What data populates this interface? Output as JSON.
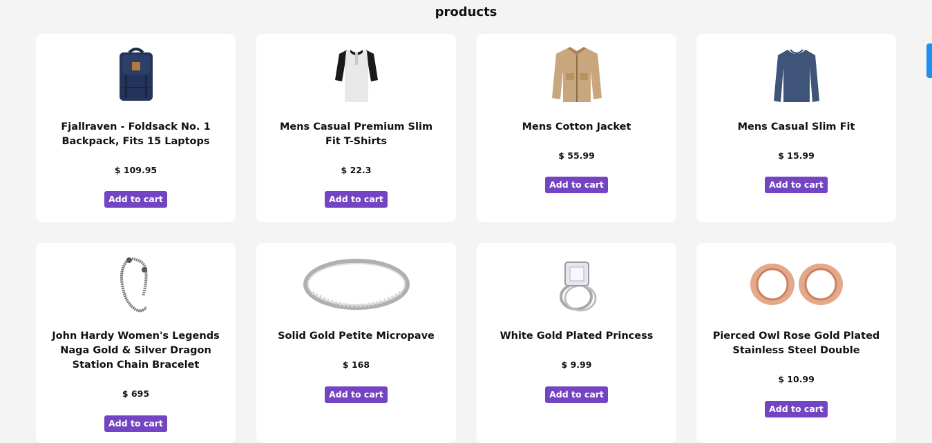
{
  "page": {
    "title": "products"
  },
  "products": [
    {
      "title": "Fjallraven - Foldsack No. 1 Backpack, Fits 15 Laptops",
      "price": "$ 109.95",
      "button": "Add to cart",
      "icon": "backpack-icon"
    },
    {
      "title": "Mens Casual Premium Slim Fit T-Shirts",
      "price": "$ 22.3",
      "button": "Add to cart",
      "icon": "tshirt-icon"
    },
    {
      "title": "Mens Cotton Jacket",
      "price": "$ 55.99",
      "button": "Add to cart",
      "icon": "jacket-icon"
    },
    {
      "title": "Mens Casual Slim Fit",
      "price": "$ 15.99",
      "button": "Add to cart",
      "icon": "longsleeve-icon"
    },
    {
      "title": "John Hardy Women's Legends Naga Gold & Silver Dragon Station Chain Bracelet",
      "price": "$ 695",
      "button": "Add to cart",
      "icon": "bracelet-icon"
    },
    {
      "title": "Solid Gold Petite Micropave",
      "price": "$ 168",
      "button": "Add to cart",
      "icon": "ring-band-icon"
    },
    {
      "title": "White Gold Plated Princess",
      "price": "$ 9.99",
      "button": "Add to cart",
      "icon": "diamond-ring-icon"
    },
    {
      "title": "Pierced Owl Rose Gold Plated Stainless Steel Double",
      "price": "$ 10.99",
      "button": "Add to cart",
      "icon": "rose-gold-plugs-icon"
    }
  ]
}
